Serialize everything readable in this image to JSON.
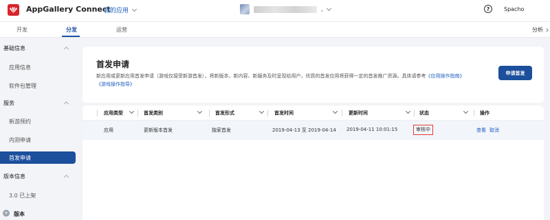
{
  "header": {
    "app_title": "AppGallery Connect",
    "my_apps": "我的应用",
    "app_separator": ",",
    "help_symbol": "?",
    "user": "Spacho"
  },
  "tabs": [
    {
      "label": "开发",
      "active": false
    },
    {
      "label": "分发",
      "active": true
    },
    {
      "label": "运营",
      "active": false
    }
  ],
  "analysis_label": "分析",
  "sidebar": {
    "groups": [
      {
        "label": "基础信息",
        "items": [
          "应用信息",
          "软件包管理"
        ]
      },
      {
        "label": "服务",
        "items": [
          "新游预约",
          "内测申请",
          "首发申请"
        ]
      },
      {
        "label": "版本信息",
        "items": [
          "3.0 已上架"
        ]
      }
    ],
    "active_item": "首发申请",
    "version_label": "版本",
    "version_icon": "+"
  },
  "panel": {
    "title": "首发申请",
    "desc_text": "新应用或更新应用首发申请（游戏仅接受新游首发），将新版本、新内容、新服务及时呈现给用户，优质的首发应用将获得一定的首发推广资源。具体请参考",
    "link1": "《应用操作指南》",
    "link2": "《游戏操作指导》",
    "apply_button": "申请首发"
  },
  "table": {
    "columns": [
      "应用类型",
      "首发类别",
      "首发形式",
      "首发时间",
      "更新时间",
      "状态",
      "操作"
    ],
    "rows": [
      {
        "app_type": "应用",
        "category": "更新版本首发",
        "form": "独家首发",
        "launch_time": "2019-04-13 至 2019-04-14",
        "update_time": "2019-04-11 10:01:15",
        "status": "审核中",
        "actions": [
          "查看",
          "取消"
        ]
      }
    ]
  },
  "colors": {
    "accent": "#1c4f9c",
    "link": "#1f5fbf",
    "logo": "#d7262c",
    "status_border": "#e53935"
  }
}
